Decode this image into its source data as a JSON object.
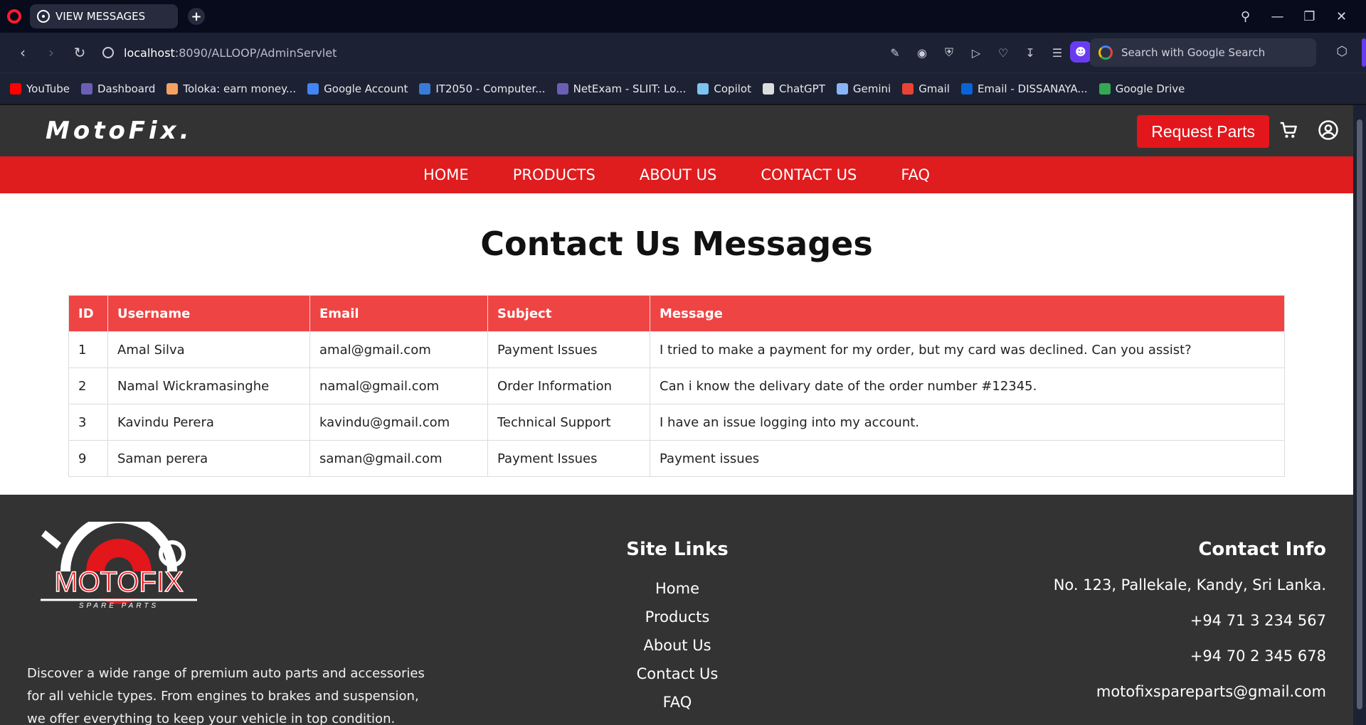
{
  "browser": {
    "tab_title": "VIEW MESSAGES",
    "url_host": "localhost",
    "url_rest": ":8090/ALLOOP/AdminServlet",
    "search_placeholder": "Search with Google Search",
    "bookmarks": [
      {
        "label": "YouTube",
        "color": "#ff0000"
      },
      {
        "label": "Dashboard",
        "color": "#6b5fb5"
      },
      {
        "label": "Toloka: earn money...",
        "color": "#f4a261"
      },
      {
        "label": "Google Account",
        "color": "#4285f4"
      },
      {
        "label": "IT2050 - Computer...",
        "color": "#3a7bd5"
      },
      {
        "label": "NetExam - SLIIT: Lo...",
        "color": "#6b5fb5"
      },
      {
        "label": "Copilot",
        "color": "#7bc4f0"
      },
      {
        "label": "ChatGPT",
        "color": "#dddddd"
      },
      {
        "label": "Gemini",
        "color": "#8ab4f8"
      },
      {
        "label": "Gmail",
        "color": "#ea4335"
      },
      {
        "label": "Email - DISSANAYA...",
        "color": "#0a64d6"
      },
      {
        "label": "Google Drive",
        "color": "#34a853"
      }
    ]
  },
  "site": {
    "logo": "MotoFix.",
    "request_button": "Request Parts",
    "nav": [
      "HOME",
      "PRODUCTS",
      "ABOUT US",
      "CONTACT US",
      "FAQ"
    ],
    "accent": "#df1c1e"
  },
  "main": {
    "title": "Contact Us Messages",
    "columns": [
      "ID",
      "Username",
      "Email",
      "Subject",
      "Message"
    ],
    "rows": [
      [
        "1",
        "Amal Silva",
        "amal@gmail.com",
        "Payment Issues",
        "I tried to make a payment for my order, but my card was declined. Can you assist?"
      ],
      [
        "2",
        "Namal Wickramasinghe",
        "namal@gmail.com",
        "Order Information",
        "Can i know the delivary date of the order number #12345."
      ],
      [
        "3",
        "Kavindu Perera",
        "kavindu@gmail.com",
        "Technical Support",
        "I have an issue logging into my account."
      ],
      [
        "9",
        "Saman perera",
        "saman@gmail.com",
        "Payment Issues",
        "Payment issues"
      ]
    ]
  },
  "footer": {
    "logo_text": "MOTOFIX",
    "logo_sub": "SPARE PARTS",
    "description": "Discover a wide range of premium auto parts and accessories for all vehicle types. From engines to brakes and suspension, we offer everything to keep your vehicle in top condition. Enjoy",
    "links_title": "Site Links",
    "links": [
      "Home",
      "Products",
      "About Us",
      "Contact Us",
      "FAQ"
    ],
    "contact_title": "Contact Info",
    "contact": [
      "No. 123, Pallekale, Kandy, Sri Lanka.",
      "+94 71 3 234 567",
      "+94 70 2 345 678",
      "motofixspareparts@gmail.com"
    ]
  }
}
